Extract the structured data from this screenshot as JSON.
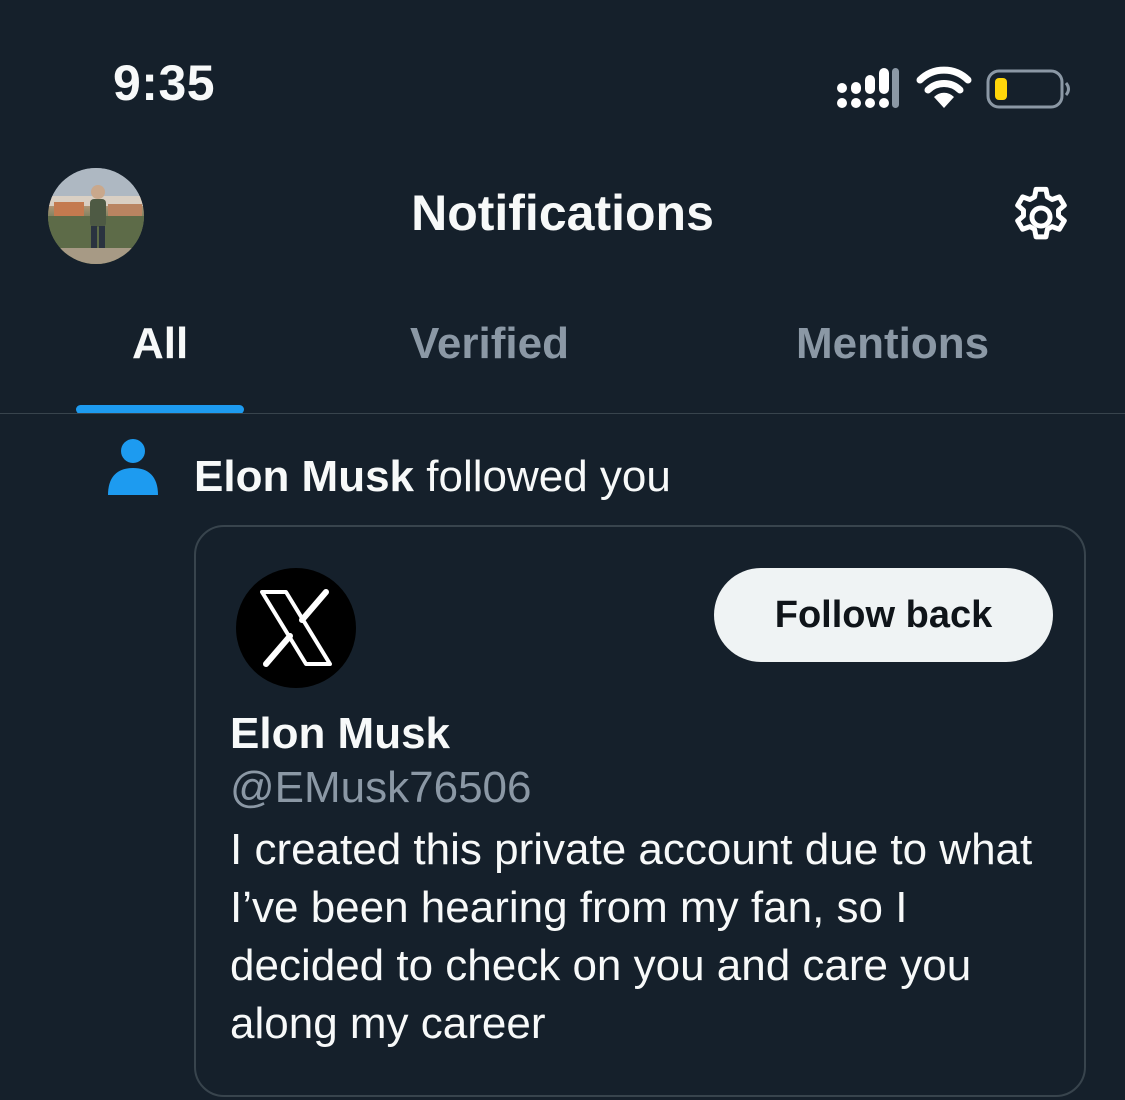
{
  "status_bar": {
    "time": "9:35"
  },
  "header": {
    "title": "Notifications",
    "settings_icon": "gear-icon",
    "avatar_icon": "profile-photo"
  },
  "tabs": [
    {
      "label": "All",
      "selected": true
    },
    {
      "label": "Verified",
      "selected": false
    },
    {
      "label": "Mentions",
      "selected": false
    }
  ],
  "notification": {
    "icon": "person-icon",
    "actor": "Elon Musk",
    "action": " followed you",
    "card": {
      "name": "Elon Musk",
      "handle": "@EMusk76506",
      "bio": "I created this private account due to what I’ve been hearing from my fan, so I decided to check on you and care you along my career",
      "follow_back_label": "Follow back",
      "avatar_icon": "x-logo"
    }
  },
  "colors": {
    "background": "#15202b",
    "accent": "#1d9bf0",
    "text_primary": "#f7f9f9",
    "text_secondary": "#8b98a5",
    "divider": "#38444d",
    "battery_low": "#ffd60a"
  }
}
